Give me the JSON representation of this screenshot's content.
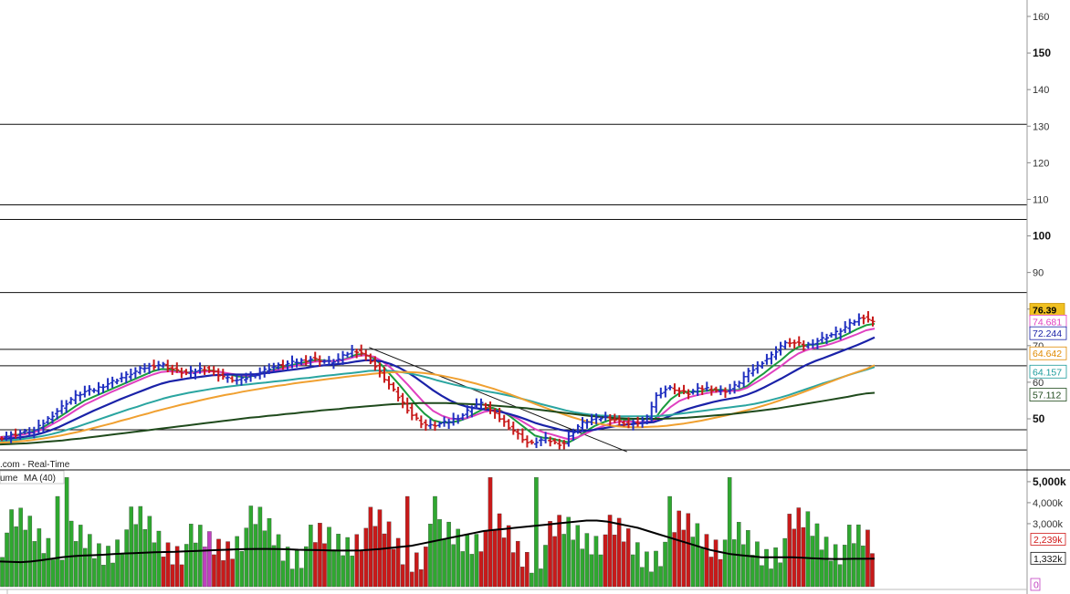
{
  "chart_data": [
    {
      "type": "line",
      "title": "",
      "price_axis": {
        "ticks": [
          "160",
          "150",
          "140",
          "130",
          "120",
          "110",
          "100",
          "90",
          "80",
          "70",
          "60",
          "50"
        ],
        "tick_values": [
          160,
          150,
          140,
          130,
          120,
          110,
          100,
          90,
          80,
          70,
          60,
          50
        ],
        "major_ticks": [
          150,
          100,
          50
        ],
        "range": [
          40,
          164
        ]
      },
      "horizontal_lines": [
        130.5,
        108.5,
        104.5,
        84.5,
        69,
        64.5,
        47,
        41.5
      ],
      "trendline": {
        "from": [
          0.345,
          69.5
        ],
        "to": [
          0.586,
          41
        ]
      },
      "price_path": [
        45,
        45.5,
        46,
        46.5,
        47,
        49,
        51,
        53,
        55,
        56.5,
        57.5,
        58,
        59,
        60,
        61,
        62,
        63,
        64,
        64.5,
        65,
        64,
        63,
        62.5,
        63,
        64,
        63,
        62,
        61,
        60.5,
        61,
        62,
        63,
        64,
        64.5,
        65,
        65.5,
        66,
        66.5,
        66,
        65.5,
        66,
        67.5,
        69,
        68,
        66,
        63,
        60,
        57,
        54,
        51,
        49,
        48,
        48.5,
        49,
        50,
        51,
        53,
        54.5,
        53,
        51,
        49,
        47,
        45,
        43,
        44,
        44.5,
        43.5,
        43,
        46,
        48.5,
        49.5,
        50,
        50.5,
        50,
        49,
        48.5,
        49,
        50,
        56,
        58,
        58.5,
        57.5,
        57,
        58,
        58.5,
        58,
        57.5,
        58,
        60,
        62.5,
        64,
        66,
        67.5,
        70,
        71,
        70.5,
        70,
        71,
        72,
        73,
        74,
        75.5,
        77,
        78,
        76.39
      ],
      "ma_series": [
        {
          "color": "#1a9b3c",
          "path": [
            45,
            45.2,
            45.6,
            46,
            46.6,
            47.6,
            49,
            50.5,
            52,
            53.6,
            55,
            56,
            57,
            58,
            59,
            60,
            61,
            62,
            63,
            63.6,
            63.5,
            63,
            62.7,
            62.8,
            63.2,
            63.2,
            62.8,
            62.2,
            61.6,
            61.4,
            61.8,
            62.5,
            63.3,
            64,
            64.5,
            65,
            65.5,
            66,
            66,
            65.8,
            65.9,
            66.6,
            67.6,
            67.6,
            66.6,
            64.6,
            62,
            59.4,
            56.6,
            53.8,
            51.4,
            49.6,
            49,
            49,
            49.4,
            50.2,
            51.6,
            52.8,
            53,
            52.2,
            50.8,
            49,
            47.2,
            45.4,
            44.8,
            44.6,
            44,
            43.6,
            44.8,
            46.6,
            48,
            49,
            49.8,
            50,
            49.6,
            49,
            49,
            49.6,
            52.8,
            55.4,
            57,
            57.4,
            57.4,
            57.6,
            57.9,
            57.9,
            57.8,
            57.9,
            59,
            60.9,
            62.5,
            64.4,
            66.1,
            68.1,
            69.6,
            70.2,
            70.3,
            70.7,
            71.4,
            72.3,
            73.4,
            74.6,
            75.6,
            76
          ]
        },
        {
          "color": "#e040c0",
          "path": [
            45,
            45.1,
            45.4,
            45.8,
            46.3,
            47.1,
            48.3,
            49.6,
            51,
            52.5,
            53.9,
            55,
            56.1,
            57.2,
            58.2,
            59.2,
            60.2,
            61.2,
            62.1,
            62.8,
            63,
            62.8,
            62.6,
            62.6,
            62.9,
            63,
            62.8,
            62.4,
            62,
            61.8,
            62,
            62.4,
            63,
            63.6,
            64.1,
            64.6,
            65.1,
            65.6,
            65.8,
            65.8,
            65.9,
            66.4,
            67.1,
            67.4,
            67,
            65.8,
            64,
            61.8,
            59.4,
            56.8,
            54.3,
            52.2,
            50.9,
            50.1,
            49.9,
            50.2,
            51,
            51.9,
            52.3,
            52,
            51.2,
            50,
            48.6,
            47.2,
            46.3,
            45.7,
            45,
            44.4,
            44.9,
            46,
            47.1,
            48,
            48.8,
            49.2,
            49.3,
            49.1,
            49.1,
            49.4,
            51.3,
            53.3,
            54.9,
            55.8,
            56.4,
            56.9,
            57.3,
            57.5,
            57.6,
            57.7,
            58.5,
            59.9,
            61.3,
            62.9,
            64.5,
            66.3,
            67.8,
            68.8,
            69.4,
            69.9,
            70.6,
            71.4,
            72.3,
            73.2,
            74.2,
            74.681
          ]
        },
        {
          "color": "#1a22a8",
          "path": [
            44.5,
            44.6,
            44.8,
            45.1,
            45.5,
            46.1,
            46.9,
            47.8,
            48.9,
            50,
            51.1,
            52.2,
            53.2,
            54.2,
            55.2,
            56.1,
            57,
            57.9,
            58.8,
            59.6,
            60.2,
            60.6,
            61,
            61.3,
            61.6,
            61.9,
            62,
            62.1,
            62.1,
            62.1,
            62.2,
            62.4,
            62.7,
            63,
            63.3,
            63.6,
            63.9,
            64.3,
            64.6,
            64.8,
            65,
            65.3,
            65.7,
            66,
            66,
            65.7,
            65,
            64,
            62.7,
            61.2,
            59.5,
            57.8,
            56.3,
            55,
            54,
            53.3,
            52.9,
            52.6,
            52.3,
            51.9,
            51.3,
            50.6,
            49.8,
            48.9,
            48.2,
            47.6,
            47,
            46.6,
            46.5,
            46.7,
            47,
            47.4,
            47.8,
            48.2,
            48.5,
            48.7,
            48.9,
            49.1,
            49.9,
            50.9,
            51.9,
            52.7,
            53.4,
            54,
            54.6,
            55.1,
            55.5,
            55.9,
            56.6,
            57.5,
            58.6,
            59.8,
            61,
            62.3,
            63.6,
            64.8,
            65.8,
            66.6,
            67.5,
            68.4,
            69.3,
            70.2,
            71.2,
            72.244
          ]
        },
        {
          "color": "#2aa5a0",
          "path": [
            44,
            44.1,
            44.3,
            44.6,
            44.9,
            45.3,
            45.8,
            46.4,
            47.1,
            47.8,
            48.6,
            49.4,
            50.2,
            51,
            51.8,
            52.6,
            53.3,
            54.1,
            54.8,
            55.5,
            56.1,
            56.6,
            57.1,
            57.5,
            57.9,
            58.3,
            58.6,
            58.9,
            59.2,
            59.4,
            59.7,
            59.9,
            60.2,
            60.4,
            60.7,
            61,
            61.2,
            61.5,
            61.8,
            62,
            62.3,
            62.5,
            62.8,
            63.1,
            63.2,
            63.2,
            63,
            62.7,
            62.3,
            61.8,
            61.2,
            60.5,
            59.9,
            59.3,
            58.8,
            58.3,
            57.8,
            57.4,
            57,
            56.5,
            56,
            55.4,
            54.8,
            54.1,
            53.5,
            52.9,
            52.3,
            51.8,
            51.4,
            51.1,
            50.9,
            50.8,
            50.7,
            50.7,
            50.7,
            50.7,
            50.7,
            50.8,
            51,
            51.3,
            51.6,
            51.9,
            52.2,
            52.5,
            52.8,
            53.1,
            53.4,
            53.7,
            54.1,
            54.6,
            55.2,
            55.8,
            56.5,
            57.3,
            58.1,
            58.9,
            59.7,
            60.4,
            61.2,
            62,
            62.7,
            63.4,
            64.157
          ]
        },
        {
          "color": "#f0a030",
          "path": [
            43.5,
            43.6,
            43.8,
            44,
            44.3,
            44.6,
            45,
            45.4,
            45.9,
            46.4,
            47,
            47.6,
            48.2,
            48.8,
            49.5,
            50.1,
            50.8,
            51.4,
            52.1,
            52.7,
            53.3,
            53.9,
            54.4,
            55,
            55.5,
            56,
            56.5,
            56.9,
            57.4,
            57.8,
            58.2,
            58.6,
            59,
            59.3,
            59.7,
            60,
            60.3,
            60.6,
            60.9,
            61.2,
            61.5,
            61.8,
            62,
            62.3,
            62.5,
            62.7,
            62.8,
            62.8,
            62.7,
            62.5,
            62.2,
            61.8,
            61.3,
            60.8,
            60.2,
            59.6,
            58.9,
            58.2,
            57.4,
            56.6,
            55.7,
            54.8,
            53.9,
            53,
            52.1,
            51.3,
            50.5,
            49.8,
            49.2,
            48.7,
            48.3,
            48,
            47.8,
            47.7,
            47.7,
            47.8,
            47.9,
            48.1,
            48.4,
            48.7,
            49.1,
            49.5,
            50,
            50.5,
            51,
            51.6,
            52.2,
            52.8,
            53.5,
            54.2,
            55,
            55.8,
            56.6,
            57.5,
            58.4,
            59.3,
            60.2,
            61.1,
            62,
            62.8,
            63.6,
            64.642
          ]
        },
        {
          "color": "#1f4a1c",
          "path": [
            43,
            43.1,
            43.2,
            43.3,
            43.5,
            43.7,
            43.9,
            44.1,
            44.4,
            44.6,
            44.9,
            45.2,
            45.5,
            45.8,
            46.1,
            46.4,
            46.7,
            47,
            47.3,
            47.6,
            47.9,
            48.2,
            48.5,
            48.8,
            49.1,
            49.4,
            49.7,
            50,
            50.3,
            50.5,
            50.8,
            51,
            51.3,
            51.5,
            51.8,
            52,
            52.3,
            52.5,
            52.7,
            53,
            53.2,
            53.4,
            53.6,
            53.8,
            54,
            54.1,
            54.2,
            54.3,
            54.3,
            54.3,
            54.3,
            54.2,
            54.1,
            54,
            53.9,
            53.7,
            53.5,
            53.3,
            53.1,
            52.9,
            52.6,
            52.3,
            52,
            51.7,
            51.4,
            51.1,
            50.8,
            50.6,
            50.4,
            50.2,
            50.1,
            50,
            50,
            50,
            50,
            50.1,
            50.2,
            50.3,
            50.5,
            50.7,
            50.9,
            51.1,
            51.3,
            51.6,
            51.9,
            52.2,
            52.5,
            52.8,
            53.2,
            53.6,
            54,
            54.4,
            54.8,
            55.2,
            55.6,
            56,
            56.5,
            56.9,
            57.112
          ]
        }
      ],
      "price_tags": [
        {
          "text": "76.39",
          "value": 79.8,
          "bg": "#f0c020",
          "fg": "#000000",
          "bold": true,
          "border": "#c89000"
        },
        {
          "text": "74.681",
          "value": 76.6,
          "bg": "#ffffff",
          "fg": "#e040c0",
          "bold": false,
          "border": "#e040c0"
        },
        {
          "text": "72.244",
          "value": 73.4,
          "bg": "#ffffff",
          "fg": "#1a22a8",
          "bold": false,
          "border": "#1a22a8"
        },
        {
          "text": "64.642",
          "value": 67.9,
          "bg": "#ffffff",
          "fg": "#e08a00",
          "bold": false,
          "border": "#e08a00"
        },
        {
          "text": "64.157",
          "value": 62.9,
          "bg": "#ffffff",
          "fg": "#1a9b9b",
          "bold": false,
          "border": "#1a9b9b"
        },
        {
          "text": "57.112",
          "value": 56.6,
          "bg": "#ffffff",
          "fg": "#1f4a1c",
          "bold": false,
          "border": "#1f4a1c"
        }
      ]
    },
    {
      "type": "bar",
      "title": "",
      "caption_top": ".com - Real-Time",
      "caption_left": "ume",
      "legend_label": "MA (40)",
      "volume_axis": {
        "ticks": [
          "5,000k",
          "4,000k",
          "3,000k"
        ],
        "tick_values": [
          5000,
          4000,
          3000
        ],
        "range": [
          0,
          5300
        ]
      },
      "volume_tags": [
        {
          "text": "2,239k",
          "value": 2239,
          "fg": "#d01818",
          "border": "#d01818"
        },
        {
          "text": "1,332k",
          "value": 1332,
          "fg": "#111111",
          "border": "#111111"
        },
        {
          "text": "0",
          "value": 0,
          "fg": "#c040c0",
          "border": "#c040c0"
        }
      ],
      "colors": {
        "up": "#2fa830",
        "down": "#c81a1a",
        "ma": "#000000",
        "neutral": "#c040c0"
      },
      "volume_ma_path": [
        1200,
        1180,
        1170,
        1200,
        1260,
        1330,
        1400,
        1450,
        1480,
        1500,
        1520,
        1550,
        1580,
        1600,
        1620,
        1640,
        1650,
        1660,
        1680,
        1700,
        1720,
        1740,
        1760,
        1780,
        1790,
        1800,
        1800,
        1790,
        1780,
        1760,
        1750,
        1740,
        1730,
        1720,
        1720,
        1730,
        1760,
        1800,
        1850,
        1900,
        1950,
        2050,
        2150,
        2250,
        2350,
        2450,
        2550,
        2650,
        2700,
        2750,
        2800,
        2850,
        2900,
        2950,
        3000,
        3050,
        3100,
        3150,
        3150,
        3100,
        3000,
        2900,
        2800,
        2650,
        2500,
        2350,
        2200,
        2050,
        1900,
        1750,
        1650,
        1550,
        1500,
        1450,
        1400,
        1400,
        1400,
        1400,
        1380,
        1350,
        1330,
        1320,
        1320,
        1330,
        1330,
        1332
      ]
    }
  ]
}
